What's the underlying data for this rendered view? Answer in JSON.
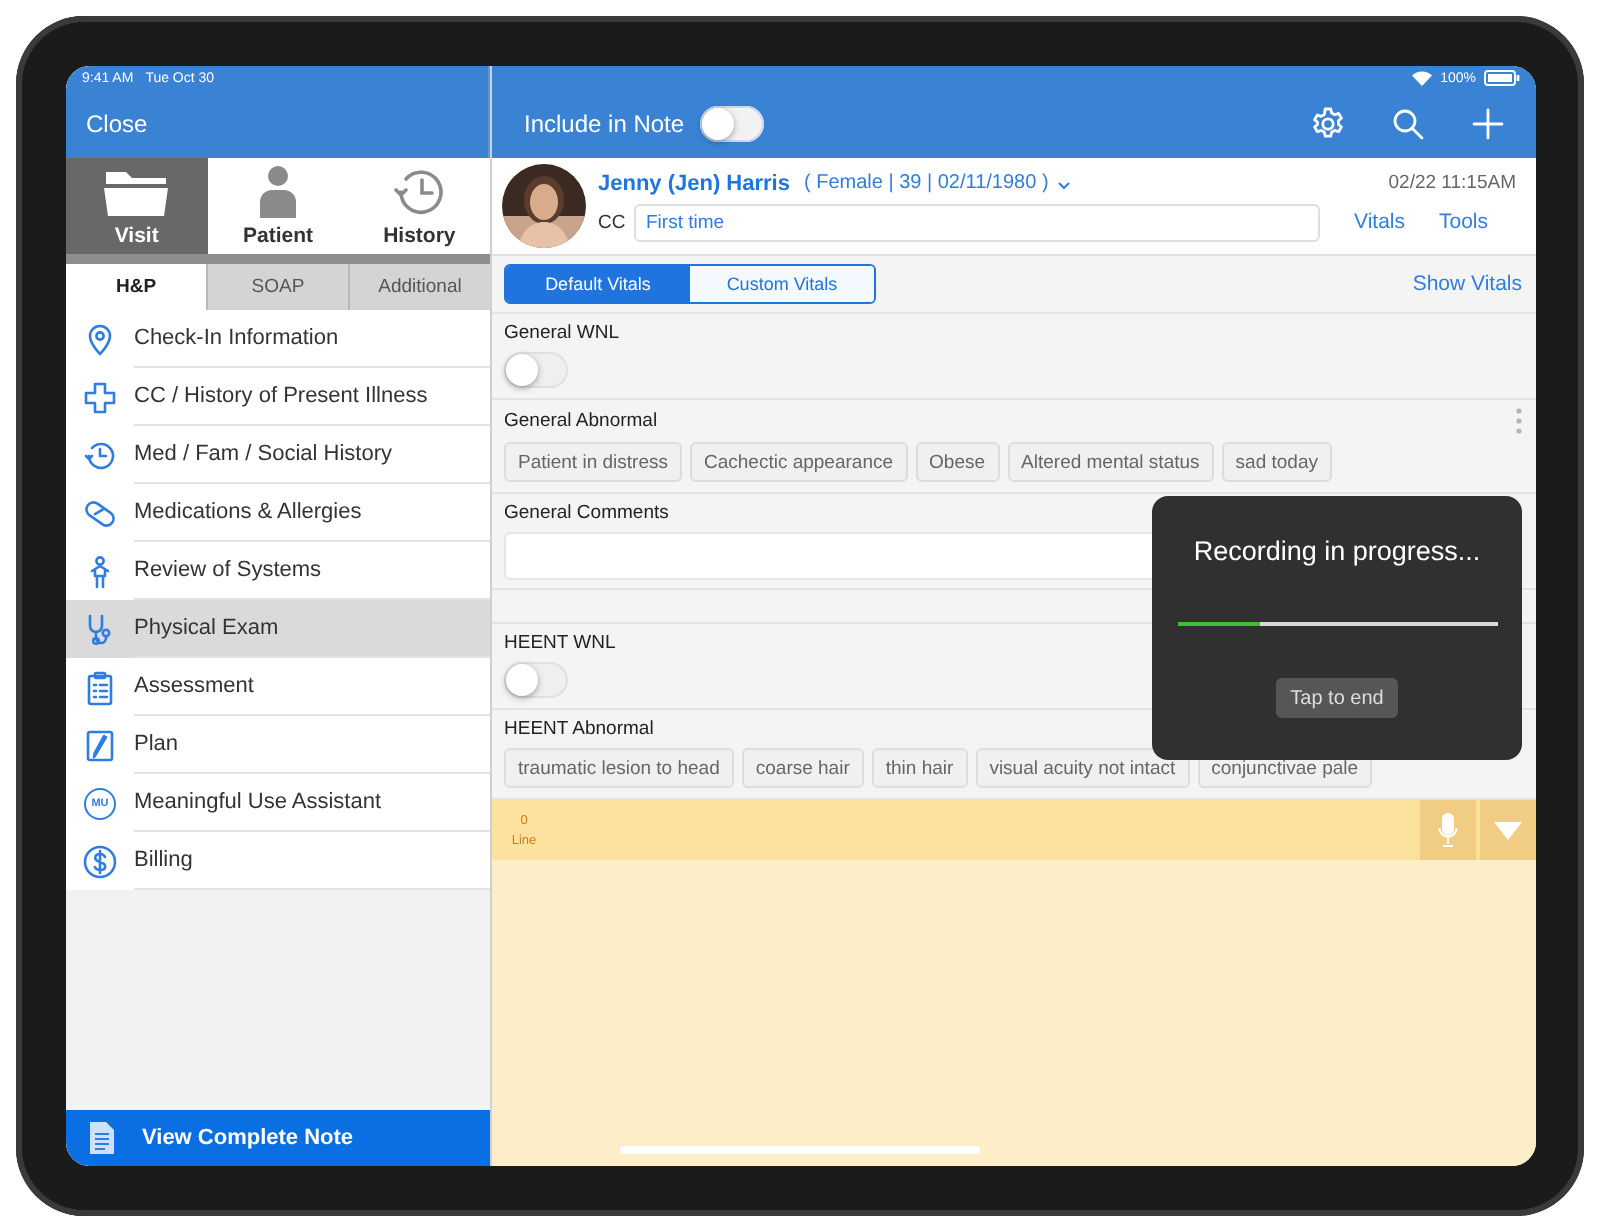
{
  "status_bar": {
    "time": "9:41 AM",
    "date": "Tue Oct 30",
    "battery": "100%"
  },
  "nav": {
    "close": "Close",
    "include_label": "Include in Note",
    "include_on": false
  },
  "modes": [
    {
      "label": "Visit",
      "kind": "folder",
      "selected": true
    },
    {
      "label": "Patient",
      "kind": "person",
      "selected": false
    },
    {
      "label": "History",
      "kind": "history",
      "selected": false
    }
  ],
  "section_tabs": [
    {
      "label": "H&P",
      "selected": true
    },
    {
      "label": "SOAP",
      "selected": false
    },
    {
      "label": "Additional",
      "selected": false
    }
  ],
  "menu": [
    {
      "label": "Check-In Information",
      "kind": "pin",
      "selected": false
    },
    {
      "label": "CC / History of Present Illness",
      "kind": "cross",
      "selected": false
    },
    {
      "label": "Med / Fam / Social History",
      "kind": "history",
      "selected": false
    },
    {
      "label": "Medications & Allergies",
      "kind": "pill",
      "selected": false
    },
    {
      "label": "Review of Systems",
      "kind": "person",
      "selected": false
    },
    {
      "label": "Physical Exam",
      "kind": "stethoscope",
      "selected": true
    },
    {
      "label": "Assessment",
      "kind": "clipboard",
      "selected": false
    },
    {
      "label": "Plan",
      "kind": "pencil",
      "selected": false
    },
    {
      "label": "Meaningful Use Assistant",
      "kind": "badge",
      "badge": "MU",
      "selected": false
    },
    {
      "label": "Billing",
      "kind": "dollar",
      "selected": false
    }
  ],
  "view_note": "View Complete Note",
  "patient": {
    "name": "Jenny (Jen) Harris",
    "details": "( Female | 39 | 02/11/1980 )",
    "timestamp": "02/22 11:15AM",
    "cc_label": "CC",
    "cc_value": "First time",
    "links": [
      "Vitals",
      "Tools"
    ]
  },
  "vitals_tabs": [
    {
      "label": "Default Vitals",
      "selected": true
    },
    {
      "label": "Custom Vitals",
      "selected": false
    }
  ],
  "show_vitals": "Show Vitals",
  "exam": [
    {
      "kind": "toggle",
      "label": "General WNL",
      "on": false
    },
    {
      "kind": "chips",
      "label": "General Abnormal",
      "chips": [
        "Patient in distress",
        "Cachectic appearance",
        "Obese",
        "Altered mental status",
        "sad today"
      ]
    },
    {
      "kind": "comment",
      "label": "General Comments"
    },
    {
      "kind": "toggle",
      "label": "HEENT WNL",
      "on": false
    },
    {
      "kind": "chips",
      "label": "HEENT Abnormal",
      "chips": [
        "traumatic lesion to head",
        "coarse hair",
        "thin hair",
        "visual acuity not intact",
        "conjunctivae pale"
      ]
    }
  ],
  "dictation": {
    "count": "0",
    "unit": "Line"
  },
  "recording": {
    "title": "Recording in progress...",
    "level": 0.26,
    "button": "Tap to end"
  }
}
